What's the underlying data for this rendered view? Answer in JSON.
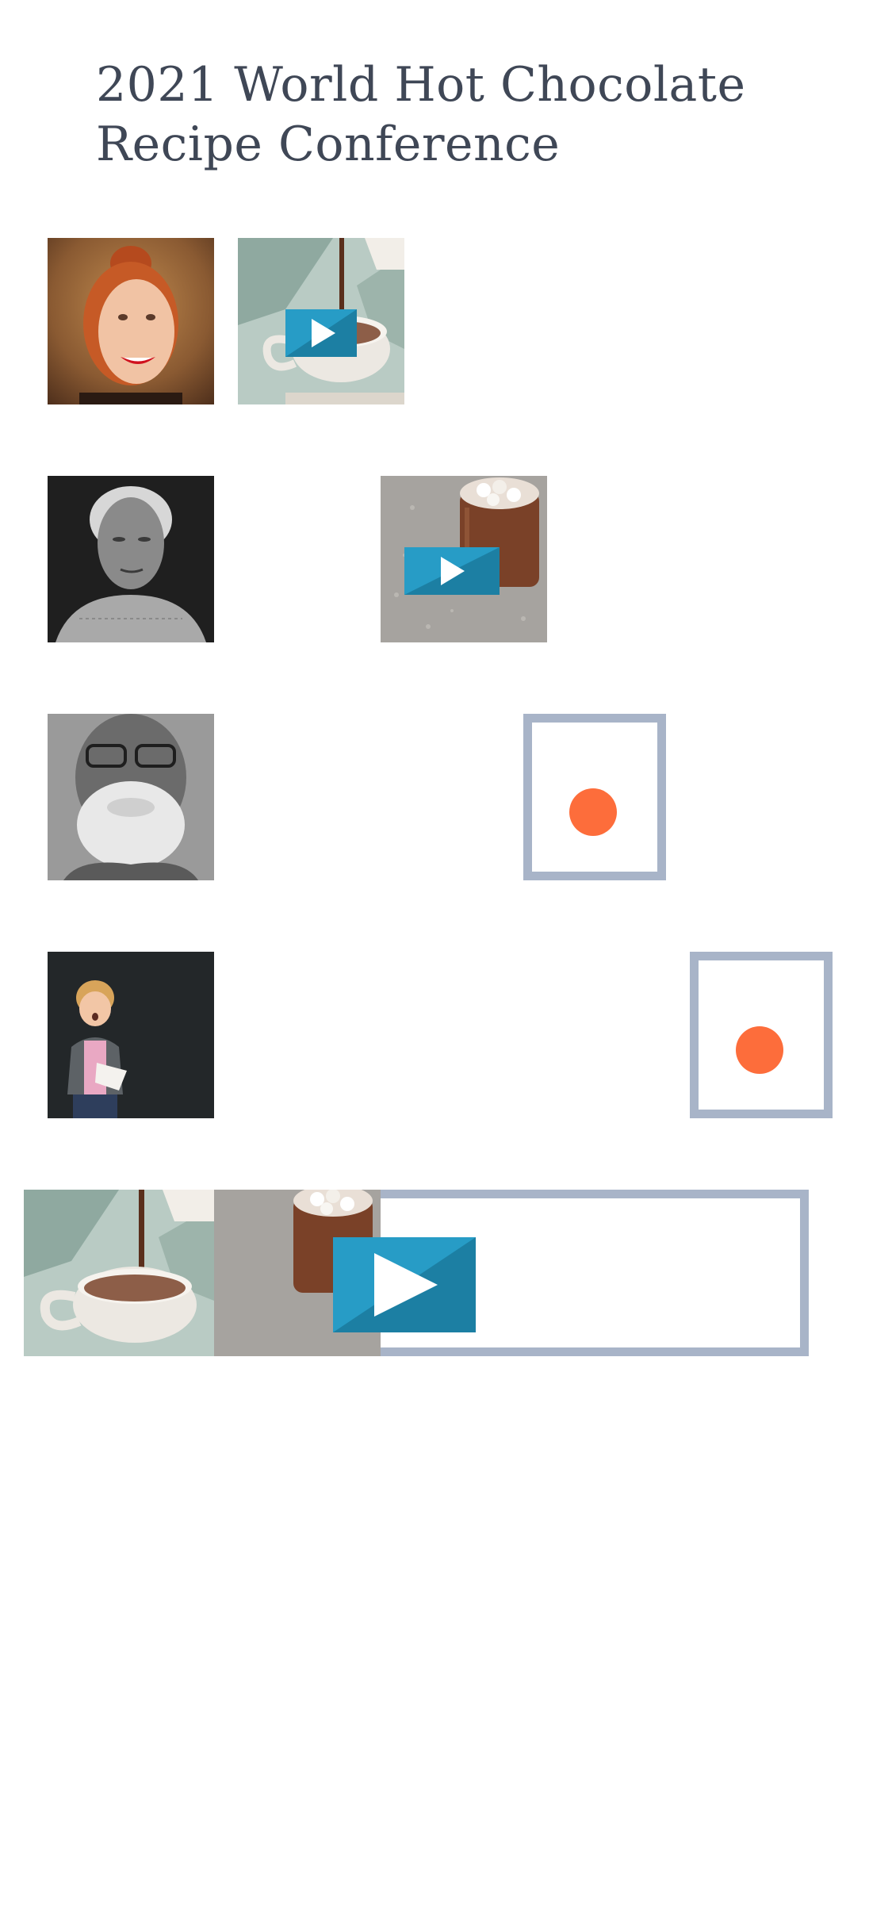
{
  "page": {
    "title": "2021 World Hot Chocolate Recipe Conference"
  },
  "tiles": [
    {
      "name": "speaker-photo-young-woman",
      "kind": "photo",
      "description_icon": "smiling-woman-photo"
    },
    {
      "name": "video-thumbnail-pouring-chocolate",
      "kind": "video",
      "icon": "play-icon"
    },
    {
      "name": "speaker-photo-elderly-woman",
      "kind": "photo"
    },
    {
      "name": "video-thumbnail-marshmallow-jar",
      "kind": "video",
      "icon": "play-icon"
    },
    {
      "name": "speaker-photo-bearded-man",
      "kind": "photo"
    },
    {
      "name": "record-placeholder-1",
      "kind": "placeholder",
      "icon": "record-dot-icon"
    },
    {
      "name": "speaker-photo-child",
      "kind": "photo"
    },
    {
      "name": "record-placeholder-2",
      "kind": "placeholder",
      "icon": "record-dot-icon"
    }
  ],
  "colors": {
    "title_text": "#3f4756",
    "play_button": "#279cc6",
    "play_button_shade": "#1c7fa3",
    "frame_border": "#a8b4c8",
    "record_dot": "#fd6d3b"
  }
}
